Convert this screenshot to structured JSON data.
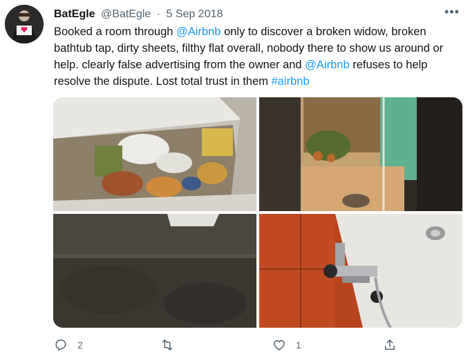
{
  "tweet": {
    "author": {
      "name": "BatEgle",
      "handle": "@BatEgle",
      "separator": "·",
      "date": "5 Sep 2018"
    },
    "more_label": "•••",
    "text": {
      "p1": "Booked a room through ",
      "mention1": "@Airbnb",
      "p2": " only to discover a broken widow, broken bathtub tap, dirty sheets, filthy flat overall, nobody there to show us around or help. clearly false advertising from the owner and ",
      "mention2": "@Airbnb",
      "p3": " refuses to help resolve the dispute. Lost total trust in them ",
      "hashtag": "#airbnb"
    },
    "actions": {
      "reply_count": "2",
      "retweet_count": "",
      "like_count": "1"
    },
    "colors": {
      "link": "#1d9bf0",
      "secondary_text": "#536471",
      "primary_text": "#0f1419"
    },
    "icons": [
      "more-icon",
      "reply-icon",
      "retweet-icon",
      "like-icon",
      "share-icon"
    ]
  }
}
